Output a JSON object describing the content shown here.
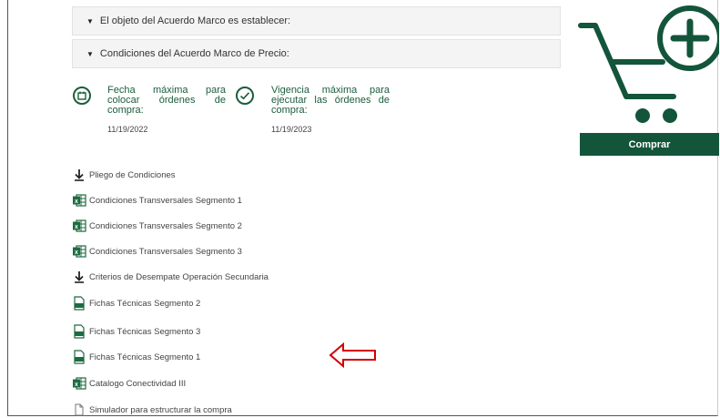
{
  "accordions": [
    {
      "label": "El objeto del Acuerdo Marco es establecer:"
    },
    {
      "label": "Condiciones del Acuerdo Marco de Precio:"
    }
  ],
  "info": {
    "fecha": {
      "label": "Fecha máxima para colocar órdenes de compra:",
      "date": "11/19/2022",
      "icon": "calendar-icon"
    },
    "vigencia": {
      "label": "Vigencia máxima para ejecutar las órdenes de compra:",
      "date": "11/19/2023",
      "icon": "check-circle-icon"
    }
  },
  "cart": {
    "button_label": "Comprar",
    "color": "#13553a"
  },
  "files": [
    {
      "label": "Pliego de Condiciones",
      "icon": "download-icon"
    },
    {
      "label": "Condiciones Transversales Segmento 1",
      "icon": "excel-icon"
    },
    {
      "label": "Condiciones Transversales Segmento 2",
      "icon": "excel-icon"
    },
    {
      "label": "Condiciones Transversales Segmento 3",
      "icon": "excel-icon"
    },
    {
      "label": "Criterios de Desempate Operación Secundaria",
      "icon": "download-icon"
    },
    {
      "label": "Fichas Técnicas Segmento 2",
      "icon": "document-icon"
    },
    {
      "label": "Fichas Técnicas Segmento 3",
      "icon": "document-icon"
    },
    {
      "label": "Fichas Técnicas Segmento 1",
      "icon": "document-icon"
    },
    {
      "label": "Catalogo Conectividad III",
      "icon": "excel-icon"
    },
    {
      "label": "Simulador para estructurar la compra",
      "icon": "file-icon"
    }
  ],
  "annotation": {
    "icon": "left-arrow-icon",
    "color": "#d40000"
  }
}
